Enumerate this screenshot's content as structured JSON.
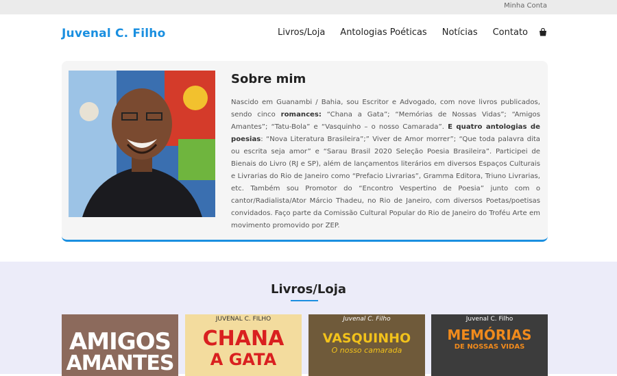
{
  "topbar": {
    "account_link": "Minha Conta"
  },
  "header": {
    "logo": "Juvenal C. Filho",
    "nav": [
      "Livros/Loja",
      "Antologias Poéticas",
      "Notícias",
      "Contato"
    ]
  },
  "about": {
    "title": "Sobre mim",
    "bio": [
      {
        "t": "Nascido em Guanambi / Bahia, sou Escritor e Advogado, com nove livros publicados, sendo cinco "
      },
      {
        "t": "romances:",
        "b": true
      },
      {
        "t": " “Chana a Gata”; “Memórias de Nossas Vidas”; “Amigos Amantes”; “Tatu-Bola” e “Vasquinho – o nosso Camarada”. "
      },
      {
        "t": "E quatro antologias de poesias",
        "b": true
      },
      {
        "t": ": “Nova Literatura Brasileira”;” Viver de Amor morrer”; “Que toda palavra dita ou escrita seja amor” e “Sarau Brasil 2020 Seleção Poesia Brasileira”. Participei de Bienais do Livro (RJ e SP), além de lançamentos literários em diversos Espaços Culturais e Livrarias do Rio de Janeiro como “Prefacio Livrarias”, Gramma Editora, Triuno Livrarias, etc. Também sou Promotor do “Encontro Vespertino de Poesia” junto com o cantor/Radialista/Ator Márcio Thadeu, no Rio de Janeiro, com diversos Poetas/poetisas  convidados. Faço parte da Comissão Cultural Popular do Rio de Janeiro do Troféu Arte em movimento promovido por ZEP."
      }
    ]
  },
  "shop": {
    "title": "Livros/Loja",
    "books": [
      {
        "author": "",
        "line1": "AMIGOS",
        "line2": "AMANTES"
      },
      {
        "author": "JUVENAL C. FILHO",
        "line1": "CHANA",
        "line2": "A GATA"
      },
      {
        "author": "Juvenal C. Filho",
        "line1": "VASQUINHO",
        "line2": "O nosso camarada"
      },
      {
        "author": "Juvenal C. Filho",
        "line1": "MEMÓRIAS",
        "line2": "DE NOSSAS VIDAS"
      }
    ]
  },
  "colors": {
    "accent": "#1a8fe0",
    "topbar": "#ebebeb",
    "shop_bg": "#ececf9",
    "about_bg": "#f5f5f5"
  }
}
